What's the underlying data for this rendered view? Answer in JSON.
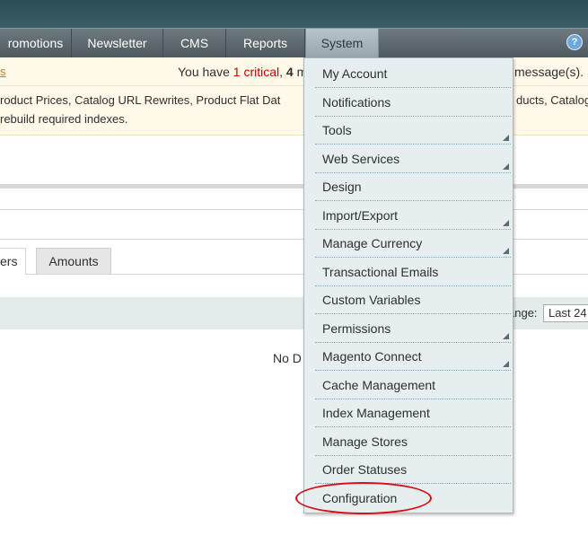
{
  "nav": {
    "items": [
      "romotions",
      "Newsletter",
      "CMS",
      "Reports",
      "System"
    ],
    "help_icon": "help-icon"
  },
  "notice": {
    "link_text": "s",
    "msg_pre": "You have ",
    "critical_count": "1",
    "critical_word": " critical",
    "comma": ", ",
    "major_count": "4",
    "msg_tail": " m",
    "msg_suffix": "message(s)."
  },
  "index_notice": {
    "line1_left": "roduct Prices, Catalog URL Rewrites, Product Flat Dat",
    "line1_right": "ducts, Catalog",
    "line2": "rebuild required indexes."
  },
  "tabs": [
    "ers",
    "Amounts"
  ],
  "filter": {
    "label": "ange:",
    "select_value": "Last 24"
  },
  "no_data": "No D",
  "system_menu": {
    "items": [
      {
        "label": "My Account",
        "submenu": false
      },
      {
        "label": "Notifications",
        "submenu": false
      },
      {
        "label": "Tools",
        "submenu": true
      },
      {
        "label": "Web Services",
        "submenu": true
      },
      {
        "label": "Design",
        "submenu": false
      },
      {
        "label": "Import/Export",
        "submenu": true
      },
      {
        "label": "Manage Currency",
        "submenu": true
      },
      {
        "label": "Transactional Emails",
        "submenu": false
      },
      {
        "label": "Custom Variables",
        "submenu": false
      },
      {
        "label": "Permissions",
        "submenu": true
      },
      {
        "label": "Magento Connect",
        "submenu": true
      },
      {
        "label": "Cache Management",
        "submenu": false
      },
      {
        "label": "Index Management",
        "submenu": false
      },
      {
        "label": "Manage Stores",
        "submenu": false
      },
      {
        "label": "Order Statuses",
        "submenu": false
      },
      {
        "label": "Configuration",
        "submenu": false
      }
    ]
  },
  "colors": {
    "highlight_circle": "#d90e14",
    "critical": "#cc0000",
    "link": "#ea7601"
  }
}
